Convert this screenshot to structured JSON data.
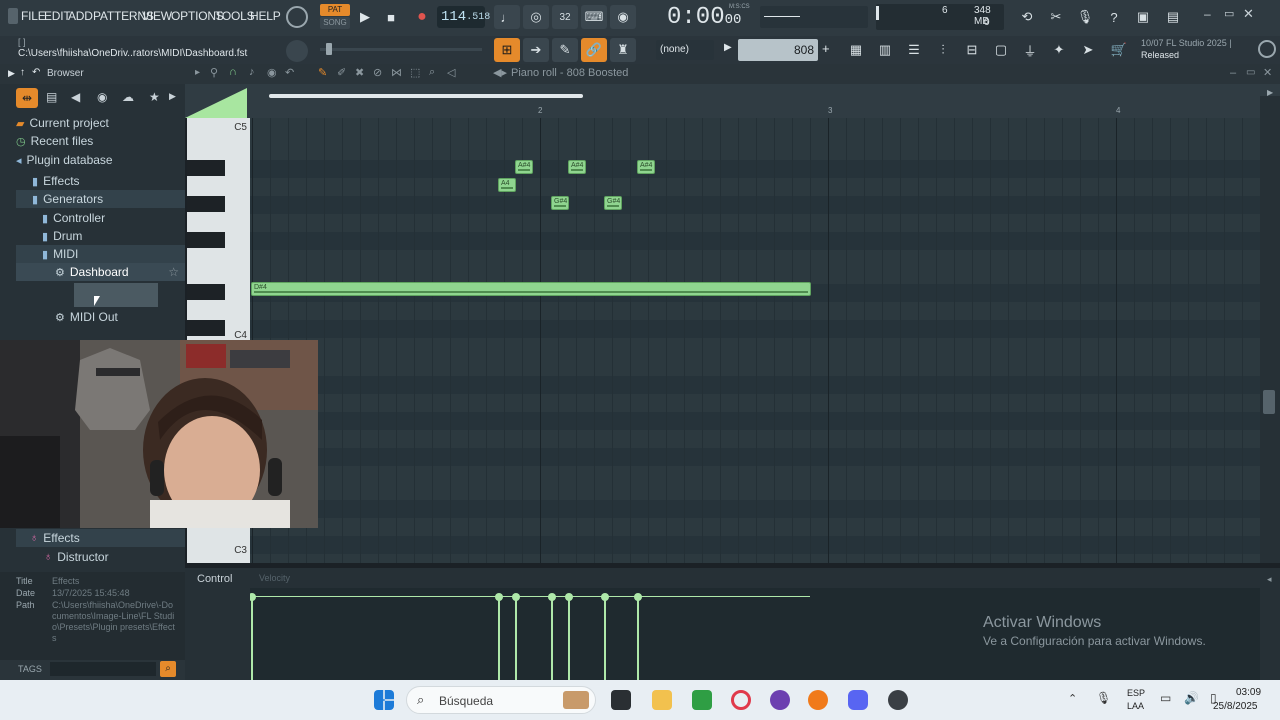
{
  "menu": [
    "FILE",
    "EDIT",
    "ADD",
    "PATTERNS",
    "VIEW",
    "OPTIONS",
    "TOOLS",
    "HELP"
  ],
  "transport": {
    "pat_label": "PAT",
    "song_label": "SONG",
    "tempo_int": "114",
    "tempo_frac": ".518",
    "time_main": "0:00",
    "time_sub": "00",
    "time_unit": "M:S:CS",
    "beat_label": "32"
  },
  "cpu": {
    "memory": "348 MB",
    "voices": "6",
    "poly": "0"
  },
  "hint": {
    "path": "C:\\Users\\fhiisha\\OneDriv..rators\\MIDI\\Dashboard.fst",
    "bracket": "[  ]"
  },
  "snap": {
    "value": "(none)"
  },
  "pattern": {
    "name": "808"
  },
  "news": {
    "line1": "10/07  FL Studio 2025 |",
    "line2": "Released"
  },
  "browser": {
    "title": "Browser",
    "items": [
      {
        "label": "Current project",
        "icon": "folder-icon"
      },
      {
        "label": "Recent files",
        "icon": "clock-icon"
      },
      {
        "label": "Plugin database",
        "icon": "plugin-icon"
      },
      {
        "label": "Effects",
        "icon": "folder-icon"
      },
      {
        "label": "Generators",
        "icon": "folder-icon"
      },
      {
        "label": "Controller",
        "icon": "folder-icon"
      },
      {
        "label": "Drum",
        "icon": "folder-icon"
      },
      {
        "label": "MIDI",
        "icon": "folder-icon"
      },
      {
        "label": "Dashboard",
        "icon": "gear-icon"
      },
      {
        "label": "MIDI Out",
        "icon": "gear-icon"
      }
    ],
    "lower_items": [
      {
        "label": "Effects"
      },
      {
        "label": "Distructor"
      }
    ],
    "info": {
      "title_key": "Title",
      "title_val": "Effects",
      "date_key": "Date",
      "date_val": "13/7/2025 15:45:48",
      "path_key": "Path",
      "path_val": "C:\\Users\\fhiisha\\OneDrive\\-Documentos\\Image-Line\\FL Studio\\Presets\\Plugin presets\\Effects"
    },
    "tags": "TAGS"
  },
  "piano_roll": {
    "title": "Piano roll - 808 Boosted",
    "bars": [
      "2",
      "3",
      "4"
    ],
    "keys": [
      "C5",
      "C4",
      "C3"
    ],
    "notes": [
      {
        "label": "A#4",
        "bar_pos": 0.96
      },
      {
        "label": "A4",
        "bar_pos": 0.9
      },
      {
        "label": "G#4",
        "bar_pos": 1.09
      },
      {
        "label": "A#4",
        "bar_pos": 1.15
      },
      {
        "label": "G#4",
        "bar_pos": 1.28
      },
      {
        "label": "A#4",
        "bar_pos": 1.4
      },
      {
        "label": "D#4",
        "bar_pos": 0.0
      }
    ]
  },
  "control": {
    "label": "Control",
    "lane": "Velocity"
  },
  "watermark": {
    "line1": "Activar Windows",
    "line2": "Ve a Configuración para activar Windows."
  },
  "taskbar": {
    "search": "Búsqueda",
    "lang1": "ESP",
    "lang2": "LAA",
    "time": "03:09",
    "date": "25/8/2025"
  },
  "colors": {
    "accent": "#e58a2b",
    "note": "#8fd58f",
    "bg": "#2c393f"
  }
}
